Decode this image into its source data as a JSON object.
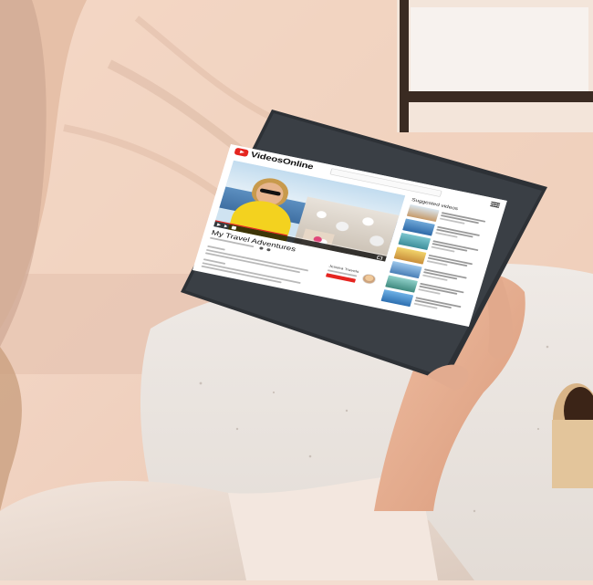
{
  "app": {
    "brand": "VideosOnline",
    "logo_icon": "play-icon"
  },
  "colors": {
    "brand_red": "#e52520",
    "text_dark": "#111111"
  },
  "video": {
    "title": "My Travel Adventures",
    "progress_fraction": 0.42
  },
  "channel": {
    "name": "Jessica Travels"
  },
  "sidebar": {
    "title": "Suggested videos"
  }
}
